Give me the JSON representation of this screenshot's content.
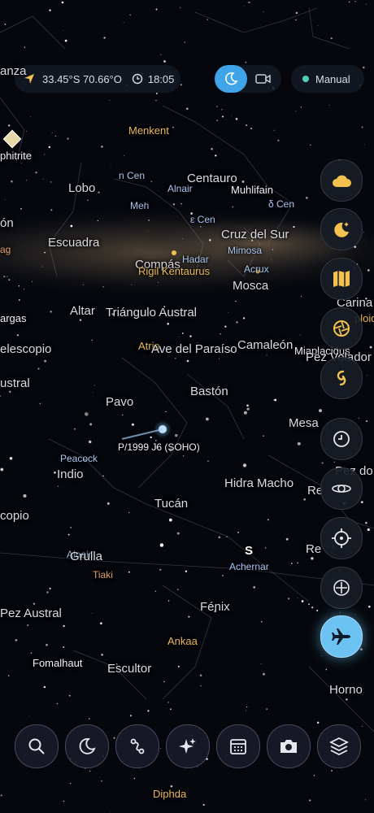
{
  "header": {
    "location": "33.45°S 70.66°O",
    "time": "18:05",
    "mode": "Manual"
  },
  "map_labels": {
    "constellations": {
      "lanza": "anza",
      "centauro": "Centauro",
      "lobo": "Lobo",
      "leon": "ón",
      "escuadra": "Escuadra",
      "compas": "Compás",
      "cruz_del_sur": "Cruz del Sur",
      "mosca": "Mosca",
      "altar": "Altar",
      "triangulo_austral": "Triángulo Austral",
      "carina": "Carina",
      "telescopio": "elescopio",
      "ave_del_paraiso": "Ave del Paraíso",
      "camaleon": "Camaleón",
      "pez_volador": "Pez Volador",
      "austral": "ustral",
      "pavo": "Pavo",
      "baston": "Bastón",
      "mesa": "Mesa",
      "indio": "Indio",
      "hidra_macho": "Hidra Macho",
      "microscopio": "copio",
      "tucan": "Tucán",
      "grulla": "Grulla",
      "pez_austral": "Pez Austral",
      "fenix": "Fénix",
      "escultor": "Escultor",
      "horno": "Horno",
      "reticulo": "Re",
      "dorado": "Pez do",
      "reticulum2": "Re"
    },
    "stars": {
      "menkent": "Menkent",
      "n_cen": "n Cen",
      "alnair_top": "Alnair",
      "muhlifain": "Muhlifain",
      "delta_cen": "δ Cen",
      "men": "Men",
      "epsilon_cen": "ε Cen",
      "mimosa": "Mimosa",
      "hadar": "Hadar",
      "rigil": "Rigil Kentaurus",
      "acrux": "Acrux",
      "atria": "Atria",
      "miaplacidus": "Miaplacidus",
      "vargas": "argas",
      "peacock": "Peacock",
      "alnair": "Alnair",
      "tiaki": "Tiaki",
      "achernar": "Achernar",
      "ankaa": "Ankaa",
      "fomalhaut": "Fomalhaut",
      "diphda": "Diphda",
      "amphitrite": "phitrite",
      "ag": "ag",
      "ploid": "ploid"
    },
    "objects": {
      "comet": "P/1999 J6 (SOHO)",
      "south": "S"
    }
  },
  "colors": {
    "accent": "#3fa4e8",
    "mode_dot": "#4fd1b9",
    "gold": "#f2c14e",
    "star_blue": "#a9c6f0"
  },
  "right_toolbar": [
    "cloud-icon",
    "moon-stars-icon",
    "map-icon",
    "aperture-icon",
    "galaxy-icon",
    "clock-icon",
    "planet-ring-icon",
    "crosshair-icon",
    "move-icon",
    "airplane-icon"
  ],
  "bottom_toolbar": [
    "search-icon",
    "moon-icon",
    "path-icon",
    "sparkle-icon",
    "calendar-icon",
    "camera-icon",
    "layers-icon"
  ]
}
